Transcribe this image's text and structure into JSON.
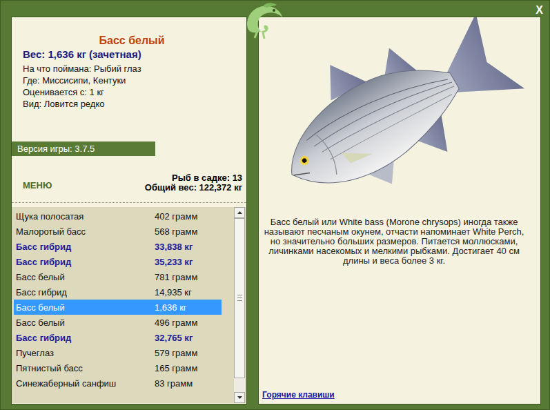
{
  "window": {
    "close": "X"
  },
  "card": {
    "title": "Басс белый",
    "weight": "Вес: 1,636 кг (зачетная)",
    "info": [
      "На что поймана: Рыбий глаз",
      "Где: Миссисипи, Кентуки",
      "Оценивается с: 1 кг",
      "Вид: Ловится редко"
    ]
  },
  "version": "Версия игры: 3.7.5",
  "menu": "МЕНЮ",
  "stats": {
    "count": "Рыб в садке: 13",
    "total": "Общий вес: 122,372 кг"
  },
  "catch_list": [
    {
      "name": "Щука полосатая",
      "weight": "402 грамм",
      "trophy": false,
      "selected": false
    },
    {
      "name": "Малоротый басс",
      "weight": "568 грамм",
      "trophy": false,
      "selected": false
    },
    {
      "name": "Басс гибрид",
      "weight": "33,838 кг",
      "trophy": true,
      "selected": false
    },
    {
      "name": "Басс гибрид",
      "weight": "35,233 кг",
      "trophy": true,
      "selected": false
    },
    {
      "name": "Басс белый",
      "weight": "781 грамм",
      "trophy": false,
      "selected": false
    },
    {
      "name": "Басс гибрид",
      "weight": "14,935 кг",
      "trophy": false,
      "selected": false
    },
    {
      "name": "Басс белый",
      "weight": "1,636 кг",
      "trophy": false,
      "selected": true
    },
    {
      "name": "Басс белый",
      "weight": "496 грамм",
      "trophy": false,
      "selected": false
    },
    {
      "name": "Басс гибрид",
      "weight": "32,765 кг",
      "trophy": true,
      "selected": false
    },
    {
      "name": "Пучеглаз",
      "weight": "579 грамм",
      "trophy": false,
      "selected": false
    },
    {
      "name": "Пятнистый басс",
      "weight": "165 грамм",
      "trophy": false,
      "selected": false
    },
    {
      "name": "Синежаберный санфиш",
      "weight": "83 грамм",
      "trophy": false,
      "selected": false
    }
  ],
  "scrollbar": {
    "level": 0.92
  },
  "description": "Басс белый или White bass (Morone chrysops) иногда также называют песчаным окунем, отчасти напоминает White Perch, но значительно больших размеров. Питается моллюсками, личинками насекомых и мелкими рыбками. Достигает 40 см длины и веса более 3 кг.",
  "hotkeys": "Горячие клавиши"
}
